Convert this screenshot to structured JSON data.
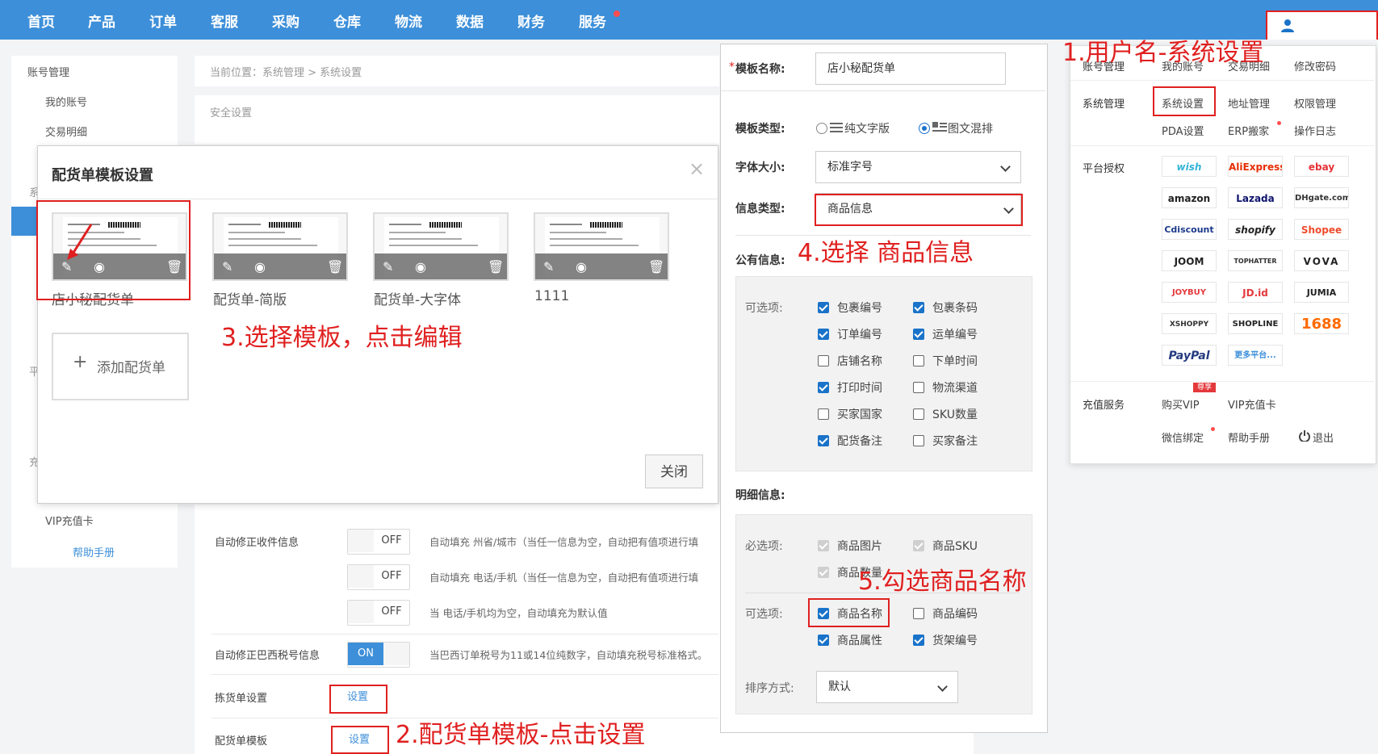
{
  "nav": {
    "items": [
      "首页",
      "产品",
      "订单",
      "客服",
      "采购",
      "仓库",
      "物流",
      "数据",
      "财务",
      "服务"
    ]
  },
  "sidebar": {
    "account_mgmt": "账号管理",
    "my_account": "我的账号",
    "transactions": "交易明细",
    "vip_card": "VIP充值卡",
    "help": "帮助手册",
    "frag1": "系",
    "frag2": "平",
    "frag3": "充"
  },
  "breadcrumb": "当前位置：系统管理 > 系统设置",
  "security_setting": "安全设置",
  "settings": {
    "auto_fix_address": "自动修正收件信息",
    "auto_fix_brazil": "自动修正巴西税号信息",
    "pick_list": "拣货单设置",
    "packing_template": "配货单模板",
    "set_label": "设置",
    "toggle_off": "OFF",
    "toggle_on": "ON",
    "desc1": "自动填充 州省/城市（当任一信息为空，自动把有值项进行填",
    "desc2": "自动填充 电话/手机（当任一信息为空，自动把有值项进行填",
    "desc3": "当 电话/手机均为空，自动填充为默认值",
    "desc4": "当巴西订单税号为11或14位纯数字，自动填充税号标准格式。"
  },
  "modal": {
    "title": "配货单模板设置",
    "close_x": "×",
    "templates": [
      "店小秘配货单",
      "配货单-简版",
      "配货单-大字体",
      "1111"
    ],
    "add_label": "添加配货单",
    "add_icon": "+",
    "close_button": "关闭"
  },
  "form": {
    "template_name_label": "模板名称:",
    "required_mark": "*",
    "template_name_value": "店小秘配货单",
    "template_type_label": "模板类型:",
    "type_text_only": "纯文字版",
    "type_mixed": "图文混排",
    "font_size_label": "字体大小:",
    "font_size_value": "标准字号",
    "info_type_label": "信息类型:",
    "info_type_value": "商品信息",
    "public_info_label": "公有信息:",
    "optional_label": "可选项:",
    "public_options": [
      {
        "label": "包裹编号",
        "checked": true
      },
      {
        "label": "包裹条码",
        "checked": true
      },
      {
        "label": "订单编号",
        "checked": true
      },
      {
        "label": "运单编号",
        "checked": true
      },
      {
        "label": "店铺名称",
        "checked": false
      },
      {
        "label": "下单时间",
        "checked": false
      },
      {
        "label": "打印时间",
        "checked": true
      },
      {
        "label": "物流渠道",
        "checked": false
      },
      {
        "label": "买家国家",
        "checked": false
      },
      {
        "label": "SKU数量",
        "checked": false
      },
      {
        "label": "配货备注",
        "checked": true
      },
      {
        "label": "买家备注",
        "checked": false
      }
    ],
    "detail_info_label": "明细信息:",
    "required_label": "必选项:",
    "required_options": [
      "商品图片",
      "商品SKU",
      "商品数量"
    ],
    "detail_optional_label": "可选项:",
    "detail_options": [
      {
        "label": "商品名称",
        "checked": true
      },
      {
        "label": "商品编码",
        "checked": false
      },
      {
        "label": "商品属性",
        "checked": true
      },
      {
        "label": "货架编号",
        "checked": true
      }
    ],
    "sort_label": "排序方式:",
    "sort_value": "默认"
  },
  "menu": {
    "account_mgmt": "账号管理",
    "my_account": "我的账号",
    "transactions": "交易明细",
    "change_pwd": "修改密码",
    "system_mgmt": "系统管理",
    "system_settings": "系统设置",
    "address_mgmt": "地址管理",
    "permission_mgmt": "权限管理",
    "pda": "PDA设置",
    "erp_move": "ERP搬家",
    "op_log": "操作日志",
    "platform_auth": "平台授权",
    "platforms": [
      "wish",
      "AliExpress",
      "ebay",
      "amazon",
      "Lazada",
      "DHgate.com",
      "Cdiscount",
      "shopify",
      "Shopee",
      "JOOM",
      "TOPHATTER",
      "VOVA",
      "JOYBUY",
      "JD.id",
      "JUMIA",
      "XSHOPPY",
      "SHOPLINE",
      "1688",
      "PayPal",
      "更多平台..."
    ],
    "recharge_service": "充值服务",
    "buy_vip": "购买VIP",
    "vip_badge": "尊享",
    "vip_card": "VIP充值卡",
    "wechat_bind": "微信绑定",
    "help": "帮助手册",
    "logout": "退出"
  },
  "annotations": {
    "a1": "1.用户名-系统设置",
    "a2": "2.配货单模板-点击设置",
    "a3": "3.选择模板，点击编辑",
    "a4": "4.选择 商品信息",
    "a5": "5.勾选商品名称"
  },
  "colors": {
    "nav_bg": "#3d8fd9",
    "accent": "#1a73c9",
    "annotation_red": "#e02020"
  }
}
